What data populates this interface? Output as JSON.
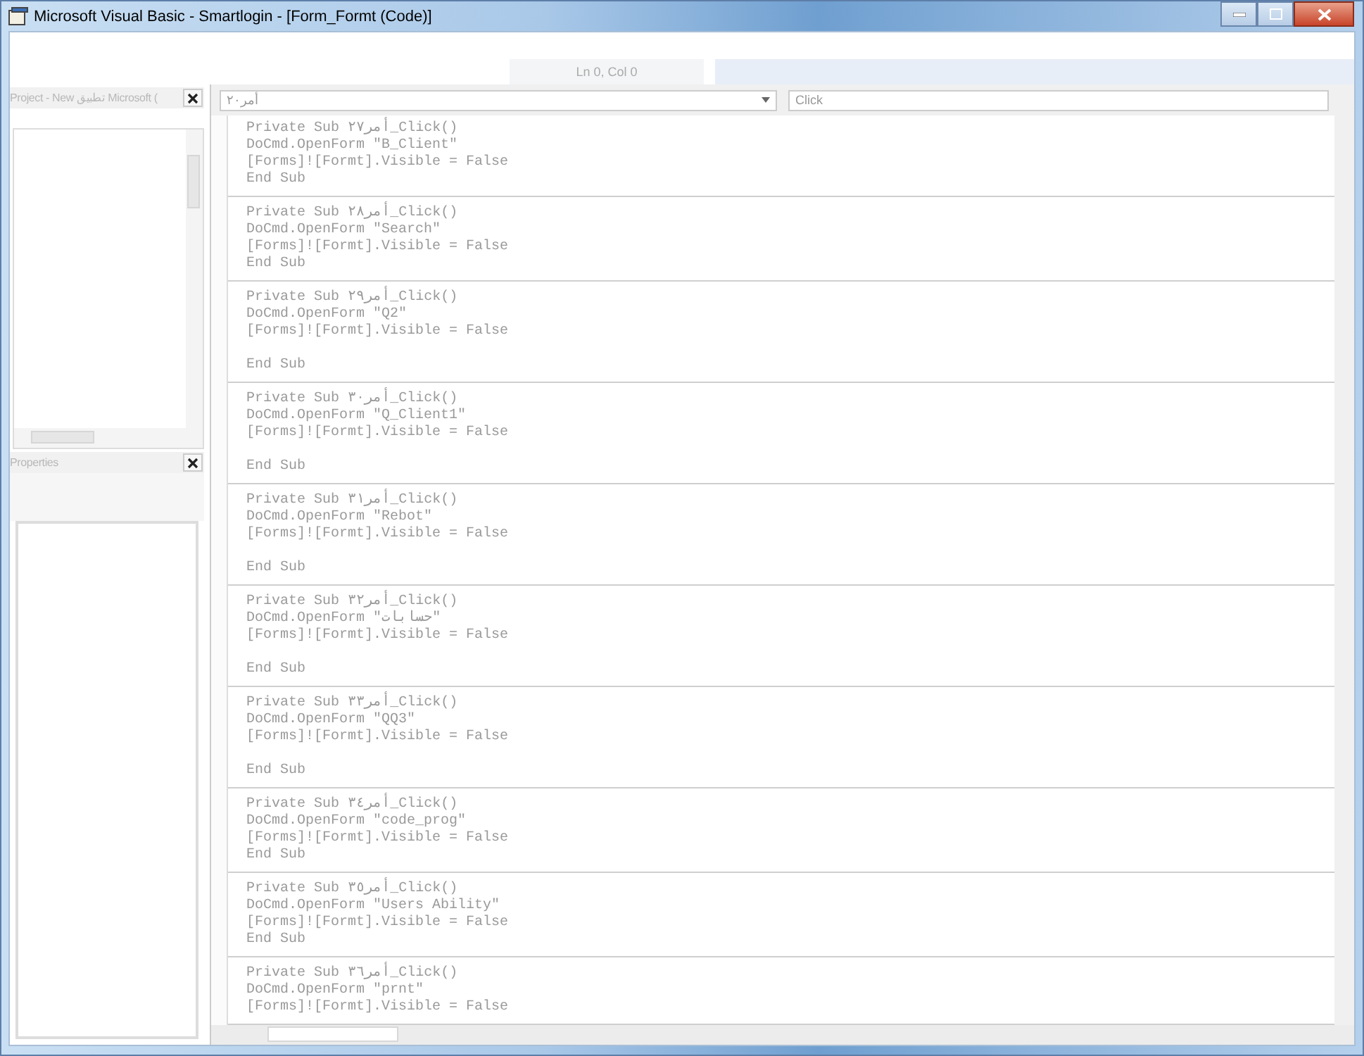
{
  "window": {
    "title": "Microsoft Visual Basic - Smartlogin - [Form_Formt (Code)]"
  },
  "status": {
    "position": "Ln 0, Col 0"
  },
  "project_panel": {
    "title": "Project - New تطبيق Microsoft ("
  },
  "properties_panel": {
    "title": "Properties"
  },
  "code_window": {
    "object_combo": "أمر٢٠",
    "procedure_combo": "Click",
    "procedures": [
      {
        "lines": [
          "Private Sub أمر٢٧_Click()",
          "DoCmd.OpenForm \"B_Client\"",
          "[Forms]![Formt].Visible = False",
          "End Sub"
        ],
        "gap_before_end": false
      },
      {
        "lines": [
          "Private Sub أمر٢٨_Click()",
          "DoCmd.OpenForm \"Search\"",
          "[Forms]![Formt].Visible = False",
          "End Sub"
        ],
        "gap_before_end": false
      },
      {
        "lines": [
          "Private Sub أمر٢٩_Click()",
          "DoCmd.OpenForm \"Q2\"",
          "[Forms]![Formt].Visible = False",
          "End Sub"
        ],
        "gap_before_end": true
      },
      {
        "lines": [
          "Private Sub أمر٣٠_Click()",
          "DoCmd.OpenForm \"Q_Client1\"",
          "[Forms]![Formt].Visible = False",
          "End Sub"
        ],
        "gap_before_end": true
      },
      {
        "lines": [
          "Private Sub أمر٣١_Click()",
          "DoCmd.OpenForm \"Rebot\"",
          "[Forms]![Formt].Visible = False",
          "End Sub"
        ],
        "gap_before_end": true
      },
      {
        "lines": [
          "Private Sub أمر٣٢_Click()",
          "DoCmd.OpenForm \"حسابات\"",
          "[Forms]![Formt].Visible = False",
          "End Sub"
        ],
        "gap_before_end": true
      },
      {
        "lines": [
          "Private Sub أمر٣٣_Click()",
          "DoCmd.OpenForm \"QQ3\"",
          "[Forms]![Formt].Visible = False",
          "End Sub"
        ],
        "gap_before_end": true
      },
      {
        "lines": [
          "Private Sub أمر٣٤_Click()",
          "DoCmd.OpenForm \"code_prog\"",
          "[Forms]![Formt].Visible = False",
          "End Sub"
        ],
        "gap_before_end": false
      },
      {
        "lines": [
          "Private Sub أمر٣٥_Click()",
          "DoCmd.OpenForm \"Users Ability\"",
          "[Forms]![Formt].Visible = False",
          "End Sub"
        ],
        "gap_before_end": false
      },
      {
        "lines": [
          "Private Sub أمر٣٦_Click()",
          "DoCmd.OpenForm \"prnt\"",
          "[Forms]![Formt].Visible = False"
        ],
        "gap_before_end": false
      }
    ]
  }
}
